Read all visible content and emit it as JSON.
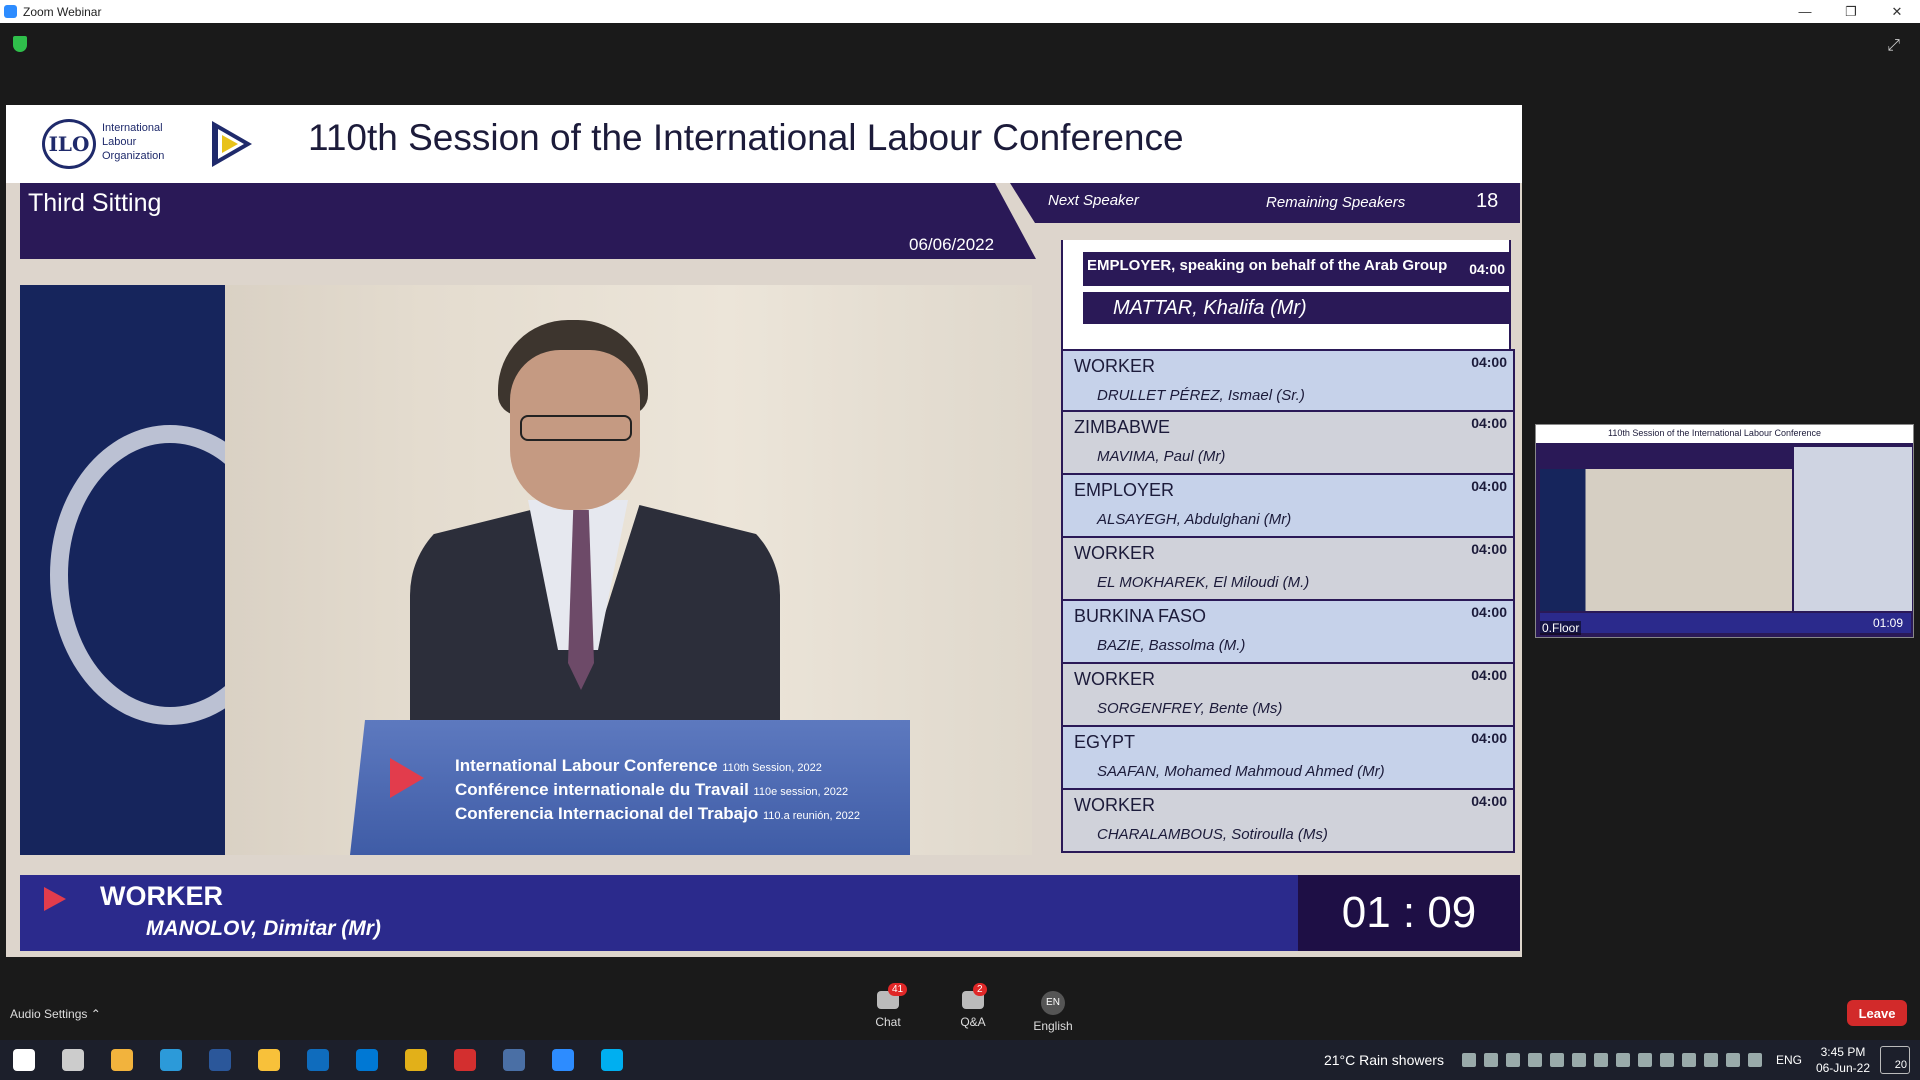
{
  "window": {
    "title": "Zoom Webinar",
    "controls": [
      "—",
      "❐",
      "✕"
    ]
  },
  "slide": {
    "org_name": "International Labour Organization",
    "logo_text": "ILO",
    "title": "110th Session of the International Labour Conference",
    "sitting": "Third Sitting",
    "date": "06/06/2022",
    "next_speaker_label": "Next Speaker",
    "remaining_label": "Remaining Speakers",
    "remaining_count": "18",
    "next": {
      "category": "EMPLOYER, speaking on behalf of the Arab Group",
      "time": "04:00",
      "name": "MATTAR, Khalifa (Mr)"
    },
    "list": [
      {
        "category": "WORKER",
        "time": "04:00",
        "name": "DRULLET PÉREZ, Ismael (Sr.)"
      },
      {
        "category": "ZIMBABWE",
        "time": "04:00",
        "name": "MAVIMA, Paul (Mr)"
      },
      {
        "category": "EMPLOYER",
        "time": "04:00",
        "name": "ALSAYEGH, Abdulghani (Mr)"
      },
      {
        "category": "WORKER",
        "time": "04:00",
        "name": "EL MOKHAREK, El Miloudi (M.)"
      },
      {
        "category": "BURKINA FASO",
        "time": "04:00",
        "name": "BAZIE, Bassolma (M.)"
      },
      {
        "category": "WORKER",
        "time": "04:00",
        "name": "SORGENFREY, Bente (Ms)"
      },
      {
        "category": "EGYPT",
        "time": "04:00",
        "name": "SAAFAN, Mohamed Mahmoud Ahmed (Mr)"
      },
      {
        "category": "WORKER",
        "time": "04:00",
        "name": "CHARALAMBOUS, Sotiroulla (Ms)"
      }
    ],
    "podium": [
      {
        "main": "International Labour Conference",
        "sub": "110th Session, 2022"
      },
      {
        "main": "Conférence internationale du Travail",
        "sub": "110e session, 2022"
      },
      {
        "main": "Conferencia Internacional del Trabajo",
        "sub": "110.a reunión, 2022"
      }
    ],
    "current": {
      "category": "WORKER",
      "name": "MANOLOV, Dimitar (Mr)",
      "timer": "01 : 09"
    }
  },
  "thumbnail": {
    "title": "110th Session of the International Labour Conference",
    "name": "0.Floor",
    "timer": "01:09"
  },
  "controls": {
    "audio_settings": "Audio Settings ⌃",
    "chat": {
      "label": "Chat",
      "badge": "41"
    },
    "qa": {
      "label": "Q&A",
      "badge": "2"
    },
    "language": {
      "code": "EN",
      "label": "English"
    },
    "leave": "Leave"
  },
  "taskbar": {
    "weather": "21°C  Rain showers",
    "lang": "ENG",
    "time": "3:45 PM",
    "date": "06-Jun-22",
    "notif_count": "20",
    "apps": [
      "start",
      "task-view",
      "store",
      "edge",
      "word",
      "explorer",
      "outlook",
      "skype-business",
      "chrome",
      "acrobat",
      "calculator",
      "zoom",
      "skype"
    ],
    "app_colors": [
      "#ffffff",
      "#cccccc",
      "#f2b33d",
      "#2c9ad9",
      "#2b579a",
      "#f8c13a",
      "#0f6cbd",
      "#0078d4",
      "#e2b019",
      "#d32f2f",
      "#4a6fa5",
      "#2d8cff",
      "#00aff0"
    ]
  }
}
